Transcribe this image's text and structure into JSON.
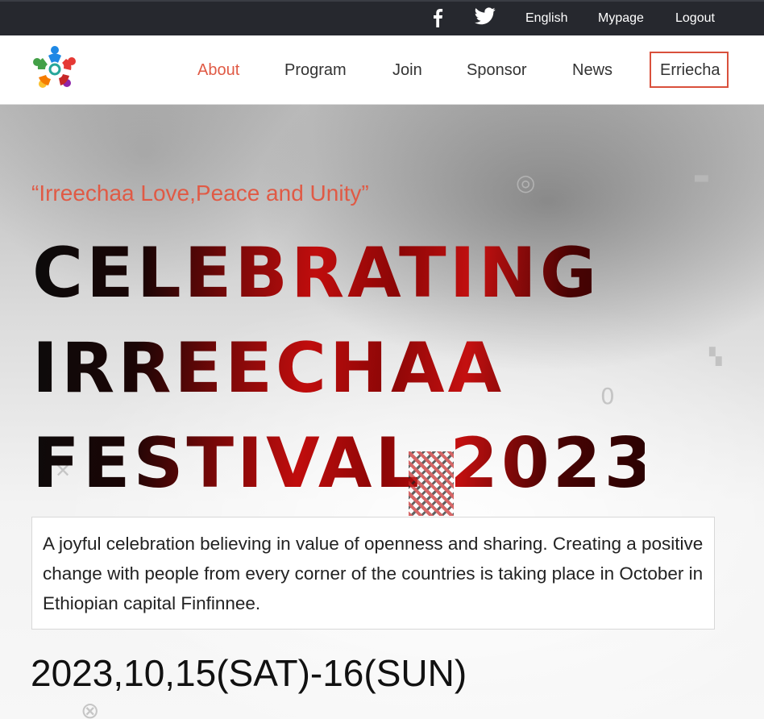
{
  "topbar": {
    "social": [
      "facebook-icon",
      "twitter-icon"
    ],
    "links": [
      "English",
      "Mypage",
      "Logout"
    ]
  },
  "nav": {
    "logo": "people-circle-logo",
    "items": [
      "About",
      "Program",
      "Join",
      "Sponsor",
      "News",
      "Erriecha"
    ],
    "active": "About",
    "accent": "#e05a45"
  },
  "hero": {
    "tagline": "“Irreechaa Love,Peace and Unity”",
    "headline": [
      "CELEBRATING",
      "IRREECHAA",
      "FESTIVAL 2023"
    ],
    "description": "A joyful celebration believing in value of openness and sharing. Creating a positive change with people from every corner of the countries is taking place in October in Ethiopian capital Finfinnee.",
    "date": "2023,10,15(SAT)-16(SUN)"
  }
}
